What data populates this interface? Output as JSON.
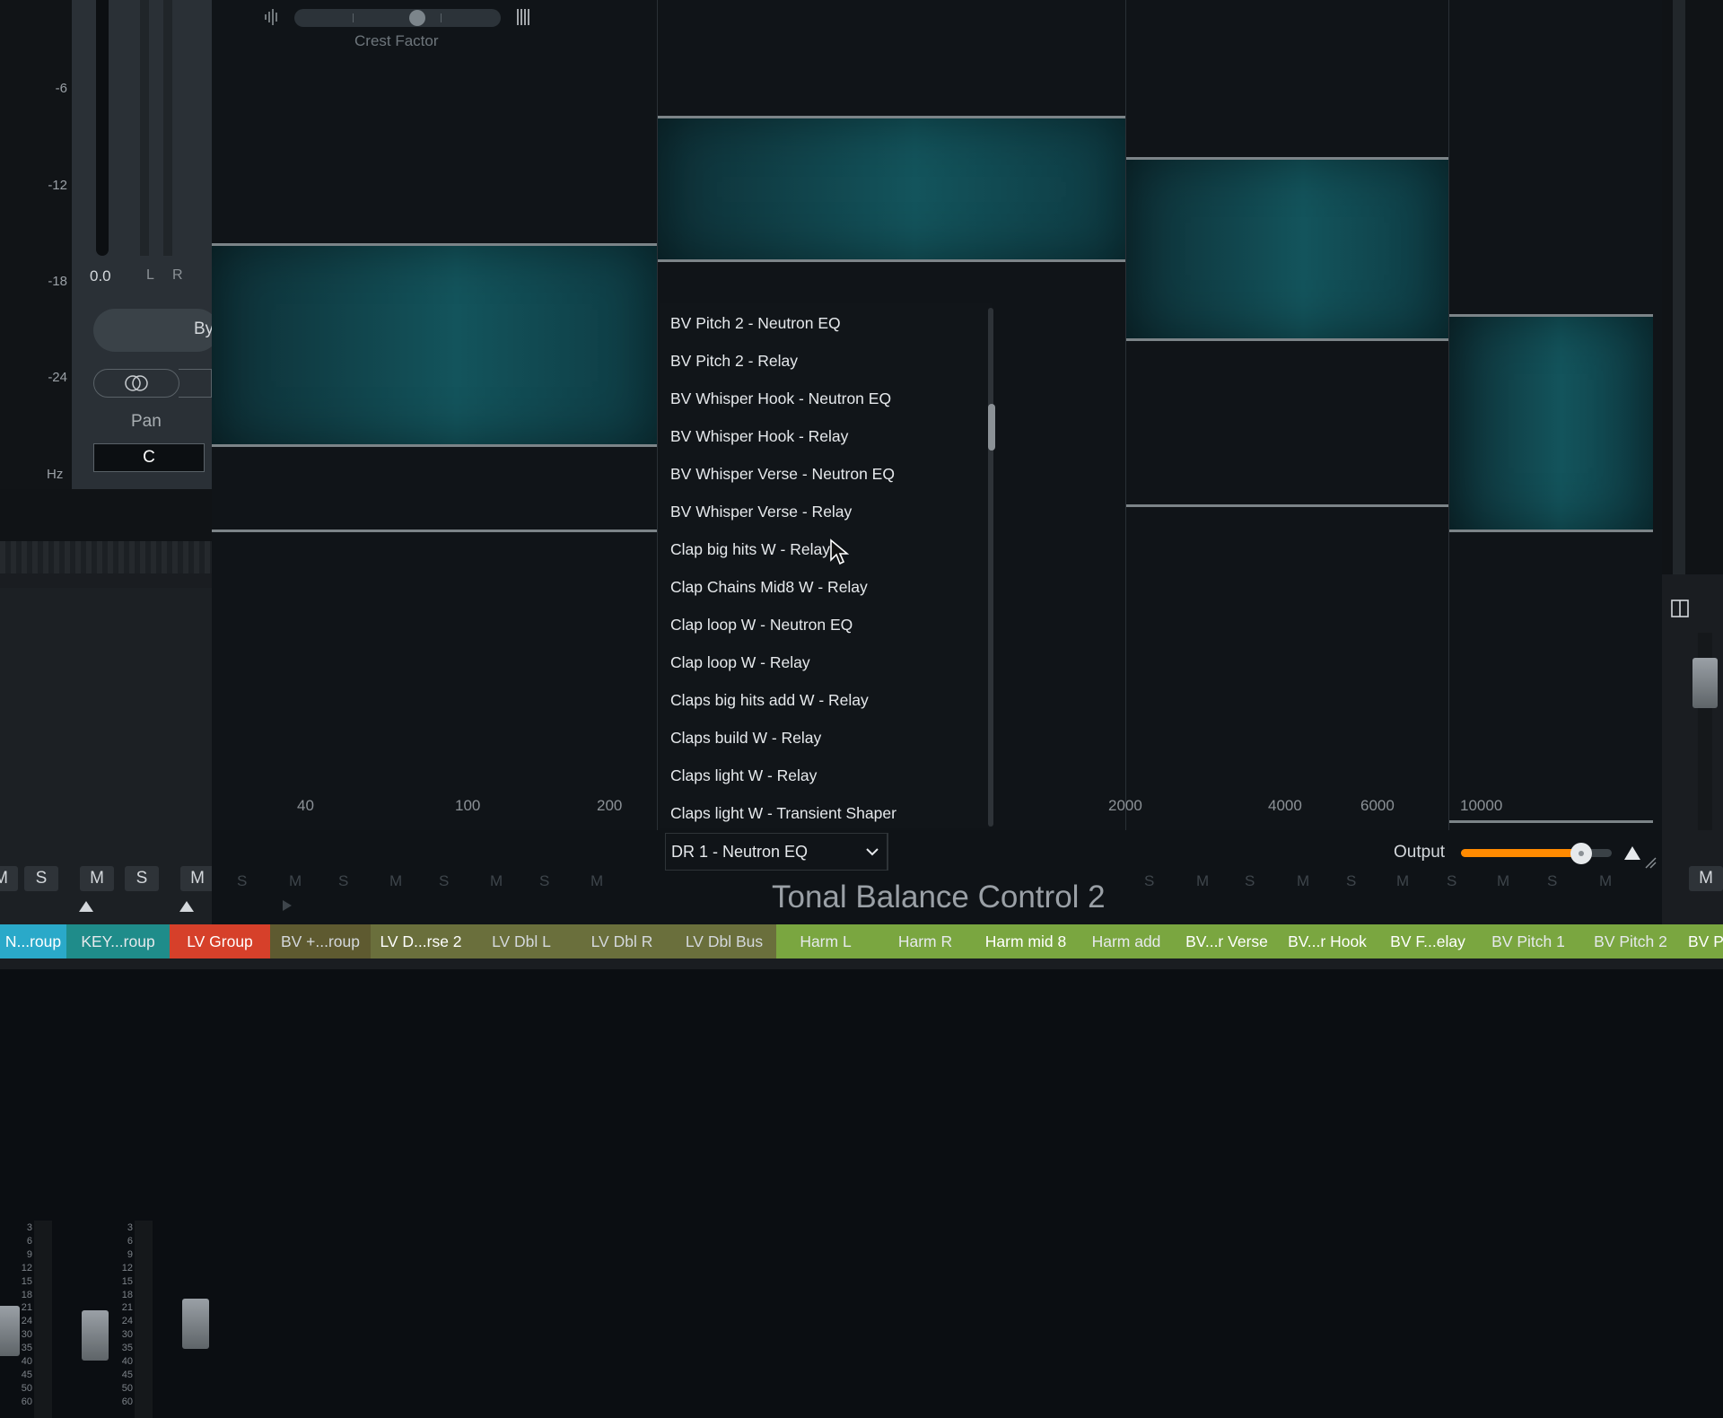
{
  "left_panel": {
    "db_scale": [
      "-6",
      "-12",
      "-18",
      "-24"
    ],
    "hz_label": "Hz",
    "volume_readout": "0.0",
    "left_label": "L",
    "right_label": "R",
    "bypass_label": "By",
    "pan_label": "Pan",
    "pan_value": "C",
    "fader_scale": [
      "3",
      "6",
      "9",
      "12",
      "15",
      "18",
      "21",
      "24",
      "30",
      "35",
      "40",
      "45",
      "50",
      "60"
    ],
    "mute_label": "M",
    "solo_label": "S"
  },
  "plugin": {
    "title": "Tonal Balance Control 2",
    "crest_factor_label": "Crest Factor",
    "freq_axis": [
      "40",
      "100",
      "200",
      "2000",
      "4000",
      "6000",
      "10000"
    ],
    "instance_selector": {
      "selected": "DR 1 - Neutron EQ"
    },
    "instance_options": [
      "BV Pitch 2 - Neutron EQ",
      "BV Pitch 2 - Relay",
      "BV Whisper Hook - Neutron EQ",
      "BV Whisper Hook - Relay",
      "BV Whisper Verse - Neutron EQ",
      "BV Whisper Verse - Relay",
      "Clap big hits W - Relay",
      "Clap Chains Mid8 W - Relay",
      "Clap loop W - Neutron EQ",
      "Clap loop W - Relay",
      "Claps big hits add W - Relay",
      "Claps build W - Relay",
      "Claps light W - Relay",
      "Claps light W - Transient Shaper"
    ],
    "output_label": "Output",
    "output_level": 0.8,
    "accent_color": "#ff8a00",
    "band_color": "#13545c"
  },
  "track_tabs": [
    {
      "label": "N...roup",
      "color": "#2aa9c9",
      "text_color": "#ffffff"
    },
    {
      "label": "KEY...roup",
      "color": "#1f8c8a",
      "text_color": "#e6e9ec"
    },
    {
      "label": "LV Group",
      "color": "#d6402a",
      "text_color": "#ffffff"
    },
    {
      "label": "BV +...roup",
      "color": "#5e5a30",
      "text_color": "#d4d8dc"
    },
    {
      "label": "LV D...rse 2",
      "color": "#6a6f3c",
      "text_color": "#ffffff"
    },
    {
      "label": "LV Dbl L",
      "color": "#6a6f3c",
      "text_color": "#d4d8dc"
    },
    {
      "label": "LV Dbl R",
      "color": "#6a6f3c",
      "text_color": "#d4d8dc"
    },
    {
      "label": "LV Dbl Bus",
      "color": "#6a6f3c",
      "text_color": "#d4d8dc"
    },
    {
      "label": "Harm L",
      "color": "#7aa640",
      "text_color": "#e6e9ec"
    },
    {
      "label": "Harm R",
      "color": "#7aa640",
      "text_color": "#e6e9ec"
    },
    {
      "label": "Harm mid 8",
      "color": "#7aa640",
      "text_color": "#ffffff"
    },
    {
      "label": "Harm add",
      "color": "#7aa640",
      "text_color": "#e6e9ec"
    },
    {
      "label": "BV...r Verse",
      "color": "#7aa640",
      "text_color": "#ffffff"
    },
    {
      "label": "BV...r Hook",
      "color": "#7aa640",
      "text_color": "#ffffff"
    },
    {
      "label": "BV F...elay",
      "color": "#7aa640",
      "text_color": "#ffffff"
    },
    {
      "label": "BV Pitch 1",
      "color": "#7aa640",
      "text_color": "#e6e9ec"
    },
    {
      "label": "BV Pitch 2",
      "color": "#7aa640",
      "text_color": "#e6e9ec"
    },
    {
      "label": "BV P",
      "color": "#7aa640",
      "text_color": "#ffffff"
    }
  ],
  "right_strip": {
    "mute_label": "M"
  }
}
